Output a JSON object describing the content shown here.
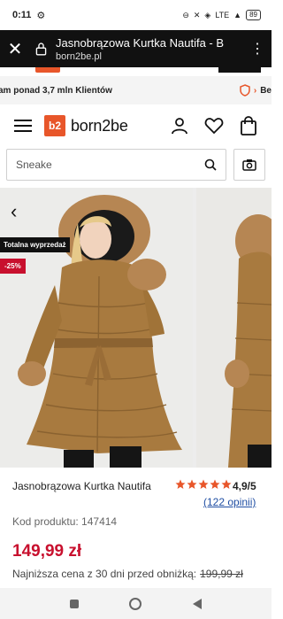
{
  "status_bar": {
    "time": "0:11",
    "network": "LTE",
    "battery": "89"
  },
  "browser": {
    "title": "Jasnobrązowa Kurtka Nautifa - B",
    "url": "born2be.pl"
  },
  "promo": {
    "left_text": "am ponad 3,7 mln Klientów",
    "right_text": "Be"
  },
  "header": {
    "logo_mark": "b2",
    "logo_text": "born2be"
  },
  "search": {
    "value": "Sneake"
  },
  "badges": {
    "bestseller": "Totalna wyprzedaż",
    "discount": "-25%"
  },
  "product": {
    "name": "Jasnobrązowa Kurtka Nautifa",
    "rating": "4,9/5",
    "reviews": "(122 opinii)",
    "code_label": "Kod produktu: 147414",
    "price": "149,99 zł",
    "lowest_price_label": "Najniższa cena z 30 dni przed obniżką:",
    "old_price": "199,99 zł",
    "stars_filled": 5
  },
  "colors": {
    "brand": "#e8562a",
    "price_red": "#c8102e",
    "link_blue": "#1f4ea3",
    "coat": "#a87a3f"
  }
}
